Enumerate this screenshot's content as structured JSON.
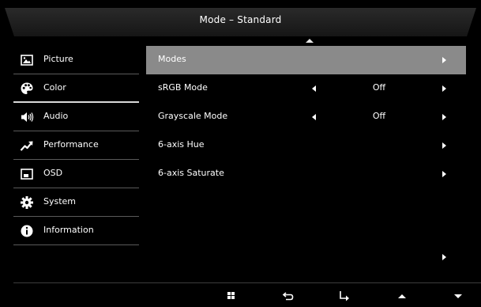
{
  "header": {
    "title": "Mode – Standard"
  },
  "sidebar": {
    "items": [
      {
        "label": "Picture",
        "icon": "picture-icon"
      },
      {
        "label": "Color",
        "icon": "palette-icon",
        "active": true
      },
      {
        "label": "Audio",
        "icon": "speaker-icon"
      },
      {
        "label": "Performance",
        "icon": "trend-icon"
      },
      {
        "label": "OSD",
        "icon": "osd-icon"
      },
      {
        "label": "System",
        "icon": "gear-icon"
      },
      {
        "label": "Information",
        "icon": "info-icon"
      }
    ]
  },
  "content": {
    "rows": [
      {
        "label": "Modes",
        "value": "",
        "selected": true
      },
      {
        "label": "sRGB Mode",
        "value": "Off"
      },
      {
        "label": "Grayscale Mode",
        "value": "Off"
      },
      {
        "label": "6-axis Hue",
        "value": ""
      },
      {
        "label": "6-axis Saturate",
        "value": ""
      }
    ]
  },
  "footer": {
    "buttons": [
      "menu-icon",
      "back-icon",
      "enter-icon",
      "up-icon",
      "down-icon"
    ]
  },
  "colors": {
    "background": "#000000",
    "selected_row": "#8a8a8a",
    "divider": "#5a5a5a",
    "text": "#ffffff"
  }
}
